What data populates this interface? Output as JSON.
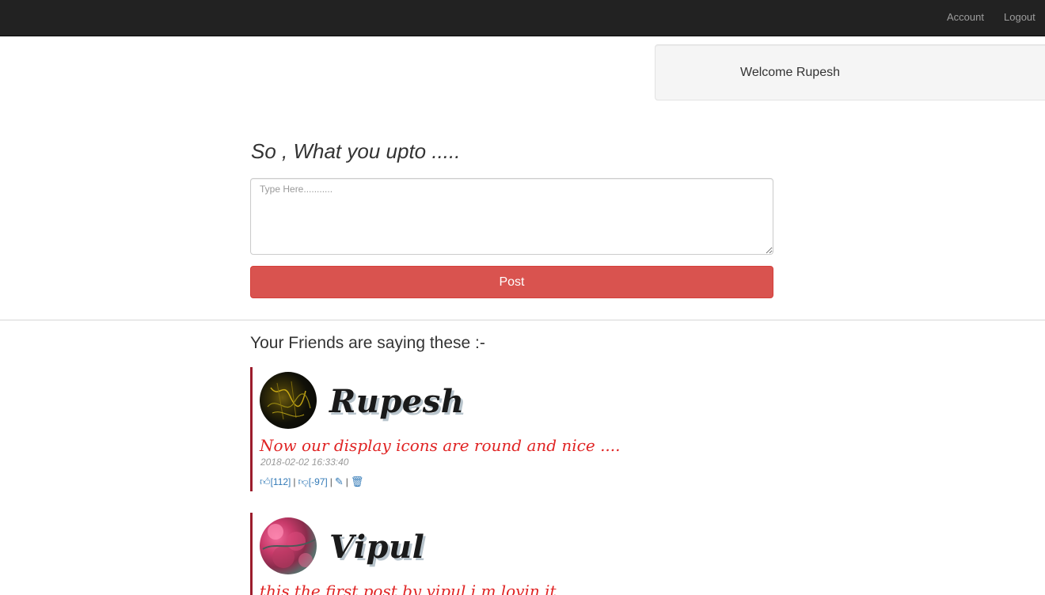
{
  "nav": {
    "account_label": "Account",
    "logout_label": "Logout"
  },
  "welcome": {
    "text": "Welcome Rupesh"
  },
  "composer": {
    "prompt": "So , What you upto .....",
    "placeholder": "Type Here...........",
    "value": "",
    "post_label": "Post"
  },
  "feed": {
    "heading": "Your Friends are saying these :-",
    "posts": [
      {
        "author": "Rupesh",
        "text": "Now our display icons are round and nice ....",
        "timestamp": "2018-02-02 16:33:40",
        "likes": "[112]",
        "dislikes": "[-97]",
        "like_icon": "thumbs-up-icon",
        "dislike_icon": "thumbs-down-icon",
        "edit_icon": "pencil-icon",
        "delete_icon": "trash-icon"
      },
      {
        "author": "Vipul",
        "text": "this the first post by vipul i m lovin it"
      }
    ]
  },
  "colors": {
    "navbar": "#222222",
    "post_button": "#d9534f",
    "post_border": "#9c1c2c",
    "post_text": "#e02424",
    "link": "#337ab7"
  }
}
